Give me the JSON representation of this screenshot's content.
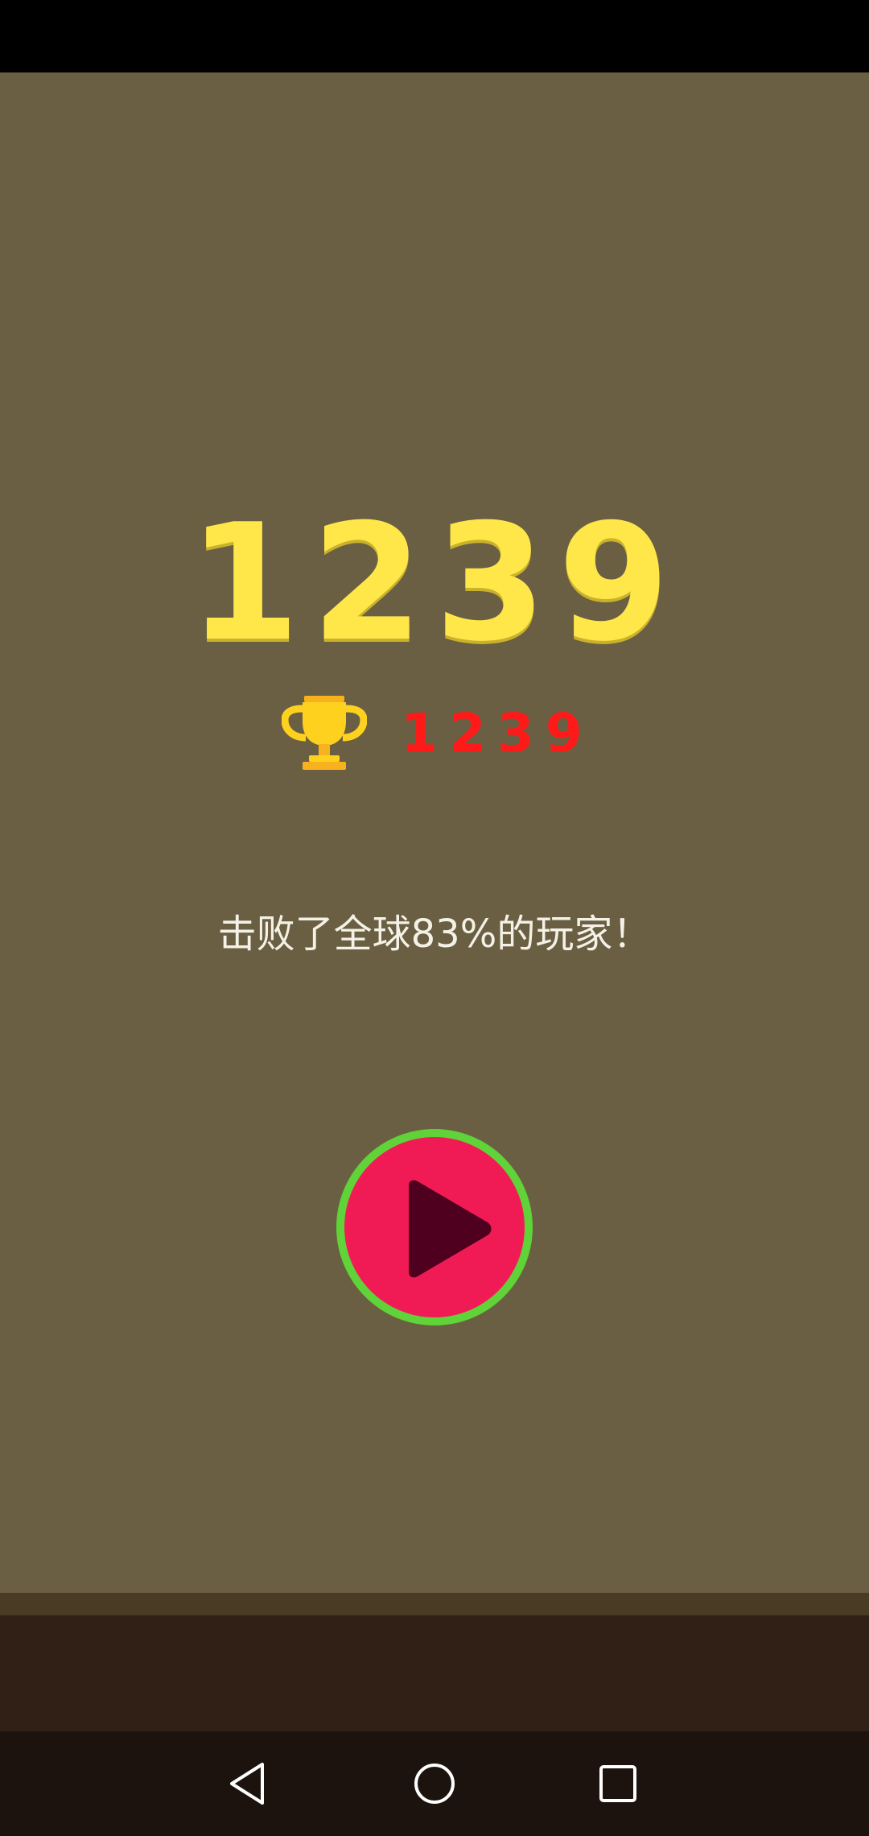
{
  "game": {
    "score": "1239",
    "best_score": "1239",
    "defeat_message": "击败了全球83%的玩家！"
  },
  "icons": {
    "trophy": "trophy-icon",
    "play": "play-icon",
    "nav_back": "triangle-back-icon",
    "nav_home": "circle-home-icon",
    "nav_recent": "square-recents-icon"
  },
  "colors": {
    "background": "#6a5f42",
    "score": "#ffe74a",
    "best_score": "#ff1a1a",
    "play_ring": "#5fd338",
    "play_fill": "#f01b55",
    "play_triangle": "#4f001e"
  }
}
